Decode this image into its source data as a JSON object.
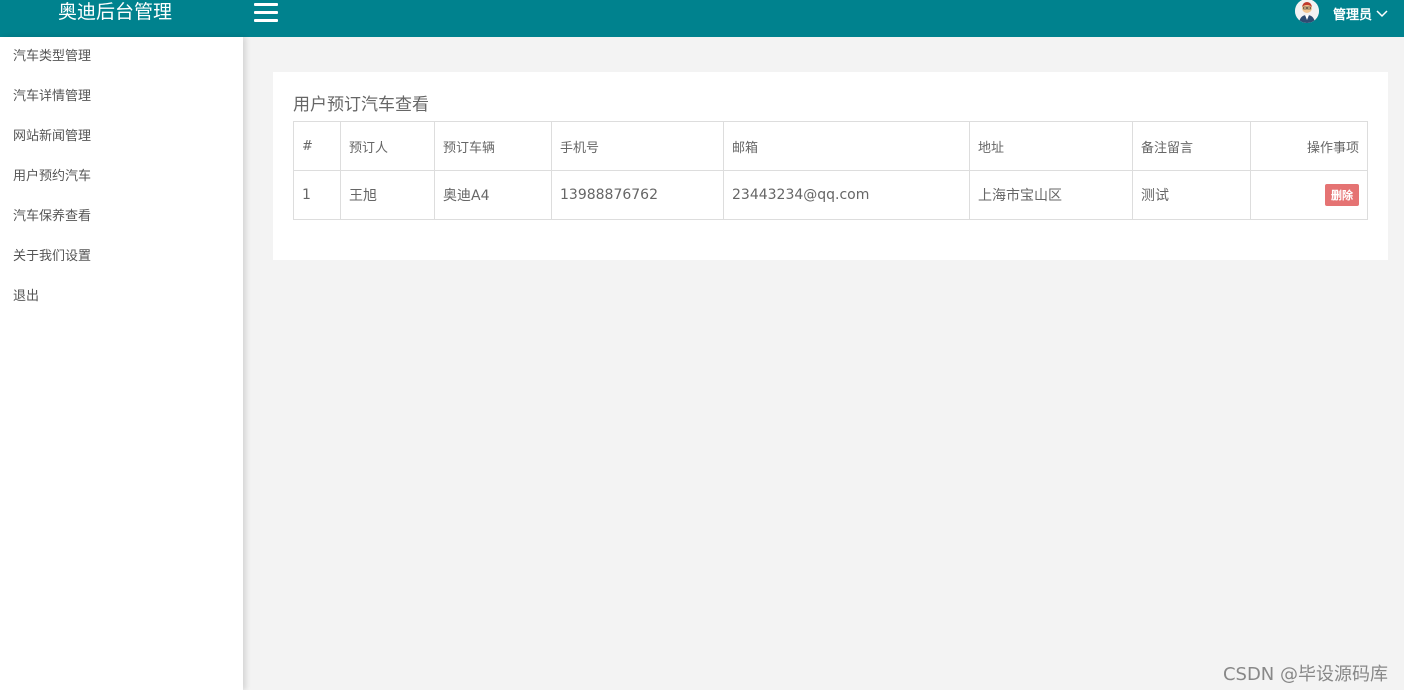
{
  "header": {
    "brand": "奥迪后台管理",
    "user_name": "管理员"
  },
  "sidebar": {
    "items": [
      {
        "label": "汽车类型管理"
      },
      {
        "label": "汽车详情管理"
      },
      {
        "label": "网站新闻管理"
      },
      {
        "label": "用户预约汽车"
      },
      {
        "label": "汽车保养查看"
      },
      {
        "label": "关于我们设置"
      },
      {
        "label": "退出"
      }
    ]
  },
  "main": {
    "title": "用户预订汽车查看",
    "columns": [
      "#",
      "预订人",
      "预订车辆",
      "手机号",
      "邮箱",
      "地址",
      "备注留言",
      "操作事项"
    ],
    "rows": [
      {
        "num": "1",
        "person": "王旭",
        "car": "奥迪A4",
        "phone": "13988876762",
        "email": "23443234@qq.com",
        "address": "上海市宝山区",
        "note": "测试",
        "delete_label": "删除"
      }
    ]
  },
  "watermark": "CSDN @毕设源码库",
  "colors": {
    "header_bg": "#00828e",
    "delete_button": "#e57373"
  }
}
